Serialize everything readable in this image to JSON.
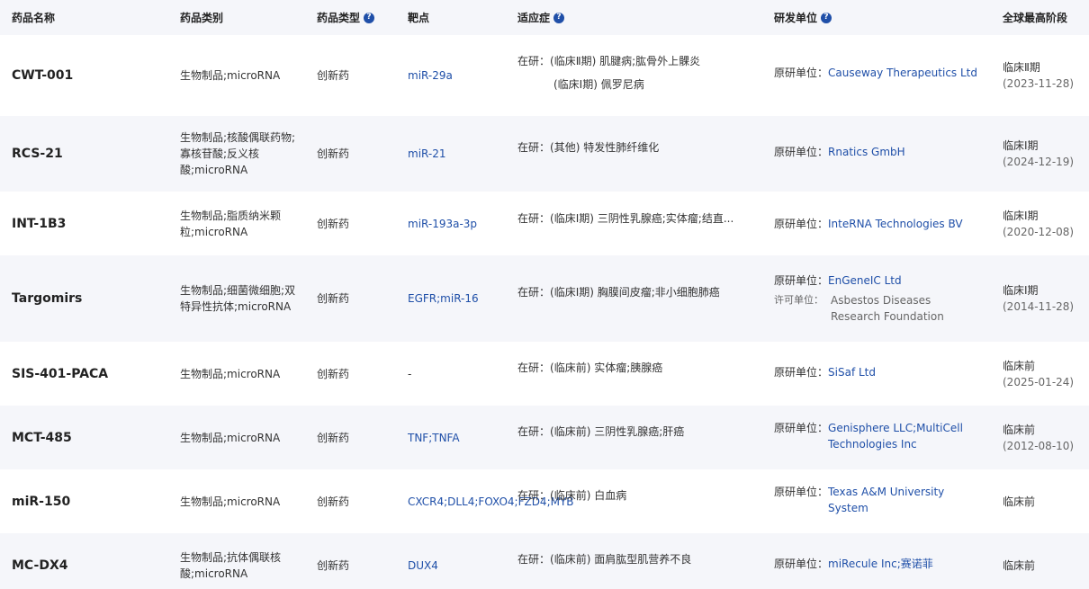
{
  "headers": {
    "name": "药品名称",
    "category": "药品类别",
    "type": "药品类型",
    "target": "靶点",
    "indication": "适应症",
    "org": "研发单位",
    "stage": "全球最高阶段"
  },
  "help_icon": "help-question-icon",
  "indication_prefix": "在研：",
  "org_label": "原研单位：",
  "license_label": "许可单位：",
  "rows": [
    {
      "name": "CWT-001",
      "category": "生物制品;microRNA",
      "type": "创新药",
      "target": "miR-29a",
      "indication_1": "(临床Ⅱ期) 肌腱病;肱骨外上髁炎",
      "indication_2": "(临床Ⅰ期) 佩罗尼病",
      "org": "Causeway Therapeutics Ltd",
      "stage": "临床Ⅱ期",
      "stage_date": "(2023-11-28)"
    },
    {
      "name": "RCS-21",
      "category": "生物制品;核酸偶联药物;寡核苷酸;反义核酸;microRNA",
      "type": "创新药",
      "target": "miR-21",
      "indication_1": "(其他) 特发性肺纤维化",
      "org": "Rnatics GmbH",
      "stage": "临床Ⅰ期",
      "stage_date": "(2024-12-19)"
    },
    {
      "name": "INT-1B3",
      "category": "生物制品;脂质纳米颗粒;microRNA",
      "type": "创新药",
      "target": "miR-193a-3p",
      "indication_1": "(临床Ⅰ期) 三阴性乳腺癌;实体瘤;结直...",
      "org": "InteRNA Technologies BV",
      "stage": "临床Ⅰ期",
      "stage_date": "(2020-12-08)"
    },
    {
      "name": "Targomirs",
      "category": "生物制品;细菌微细胞;双特异性抗体;microRNA",
      "type": "创新药",
      "target": "EGFR;miR-16",
      "indication_1": "(临床Ⅰ期) 胸膜间皮瘤;非小细胞肺癌",
      "org": "EnGeneIC Ltd",
      "license_org": "Asbestos Diseases Research Foundation",
      "stage": "临床Ⅰ期",
      "stage_date": "(2014-11-28)"
    },
    {
      "name": "SIS-401-PACA",
      "category": "生物制品;microRNA",
      "type": "创新药",
      "target": "-",
      "indication_1": "(临床前) 实体瘤;胰腺癌",
      "org": "SiSaf Ltd",
      "stage": "临床前",
      "stage_date": "(2025-01-24)"
    },
    {
      "name": "MCT-485",
      "category": "生物制品;microRNA",
      "type": "创新药",
      "target": "TNF;TNFA",
      "indication_1": "(临床前) 三阴性乳腺癌;肝癌",
      "org": "Genisphere LLC;MultiCell Technologies Inc",
      "stage": "临床前",
      "stage_date": "(2012-08-10)"
    },
    {
      "name": "miR-150",
      "category": "生物制品;microRNA",
      "type": "创新药",
      "target": "CXCR4;DLL4;FOXO4;FZD4;MYB",
      "indication_1": "(临床前) 白血病",
      "org": "Texas A&M University System",
      "stage": "临床前"
    },
    {
      "name": "MC-DX4",
      "category": "生物制品;抗体偶联核酸;microRNA",
      "type": "创新药",
      "target": "DUX4",
      "indication_1": "(临床前) 面肩肱型肌营养不良",
      "org": "miRecule Inc;赛诺菲",
      "stage": "临床前"
    }
  ]
}
